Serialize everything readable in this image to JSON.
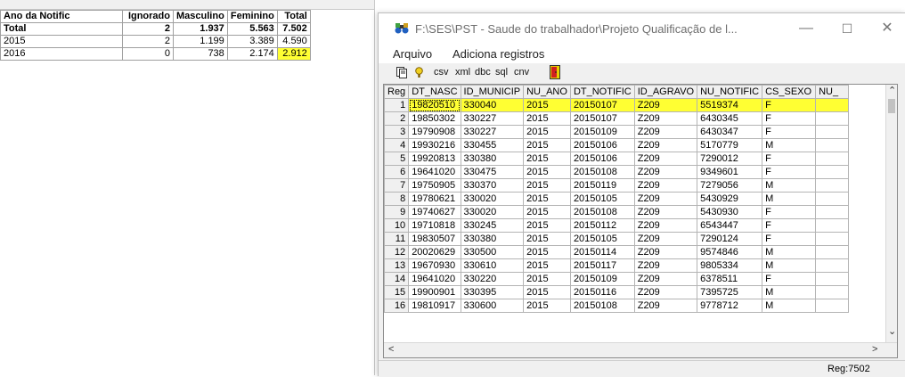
{
  "summary": {
    "headers": [
      "Ano da Notific",
      "Ignorado",
      "Masculino",
      "Feminino",
      "Total"
    ],
    "rows": [
      [
        "Total",
        "2",
        "1.937",
        "5.563",
        "7.502"
      ],
      [
        "2015",
        "2",
        "1.199",
        "3.389",
        "4.590"
      ],
      [
        "2016",
        "0",
        "738",
        "2.174",
        "2.912"
      ]
    ],
    "highlight_color": "#ffff33"
  },
  "window": {
    "title": "F:\\SES\\PST - Saude do trabalhador\\Projeto Qualificação de l...",
    "icon": "binoculars-app-icon",
    "minimize": "—",
    "maximize": "☐",
    "close": "✕"
  },
  "menu": [
    "Arquivo",
    "Adiciona registros"
  ],
  "toolbar": {
    "items": [
      "csv",
      "xml",
      "dbc",
      "sql",
      "cnv"
    ],
    "icons": [
      "copy-icon",
      "filter-icon",
      "exit-door-icon"
    ]
  },
  "grid": {
    "columns": [
      "Reg",
      "DT_NASC",
      "ID_MUNICIP",
      "NU_ANO",
      "DT_NOTIFIC",
      "ID_AGRAVO",
      "NU_NOTIFIC",
      "CS_SEXO",
      "NU_"
    ],
    "rows": [
      [
        "1",
        "19820510",
        "330040",
        "2015",
        "20150107",
        "Z209",
        "5519374",
        "F",
        ""
      ],
      [
        "2",
        "19850302",
        "330227",
        "2015",
        "20150107",
        "Z209",
        "6430345",
        "F",
        ""
      ],
      [
        "3",
        "19790908",
        "330227",
        "2015",
        "20150109",
        "Z209",
        "6430347",
        "F",
        ""
      ],
      [
        "4",
        "19930216",
        "330455",
        "2015",
        "20150106",
        "Z209",
        "5170779",
        "M",
        ""
      ],
      [
        "5",
        "19920813",
        "330380",
        "2015",
        "20150106",
        "Z209",
        "7290012",
        "F",
        ""
      ],
      [
        "6",
        "19641020",
        "330475",
        "2015",
        "20150108",
        "Z209",
        "9349601",
        "F",
        ""
      ],
      [
        "7",
        "19750905",
        "330370",
        "2015",
        "20150119",
        "Z209",
        "7279056",
        "M",
        ""
      ],
      [
        "8",
        "19780621",
        "330020",
        "2015",
        "20150105",
        "Z209",
        "5430929",
        "M",
        ""
      ],
      [
        "9",
        "19740627",
        "330020",
        "2015",
        "20150108",
        "Z209",
        "5430930",
        "F",
        ""
      ],
      [
        "10",
        "19710818",
        "330245",
        "2015",
        "20150112",
        "Z209",
        "6543447",
        "F",
        ""
      ],
      [
        "11",
        "19830507",
        "330380",
        "2015",
        "20150105",
        "Z209",
        "7290124",
        "F",
        ""
      ],
      [
        "12",
        "20020629",
        "330500",
        "2015",
        "20150114",
        "Z209",
        "9574846",
        "M",
        ""
      ],
      [
        "13",
        "19670930",
        "330610",
        "2015",
        "20150117",
        "Z209",
        "9805334",
        "M",
        ""
      ],
      [
        "14",
        "19641020",
        "330220",
        "2015",
        "20150109",
        "Z209",
        "6378511",
        "F",
        ""
      ],
      [
        "15",
        "19900901",
        "330395",
        "2015",
        "20150116",
        "Z209",
        "7395725",
        "M",
        ""
      ],
      [
        "16",
        "19810917",
        "330600",
        "2015",
        "20150108",
        "Z209",
        "9778712",
        "M",
        ""
      ]
    ],
    "selected_row": 1
  },
  "status": "Reg:7502"
}
